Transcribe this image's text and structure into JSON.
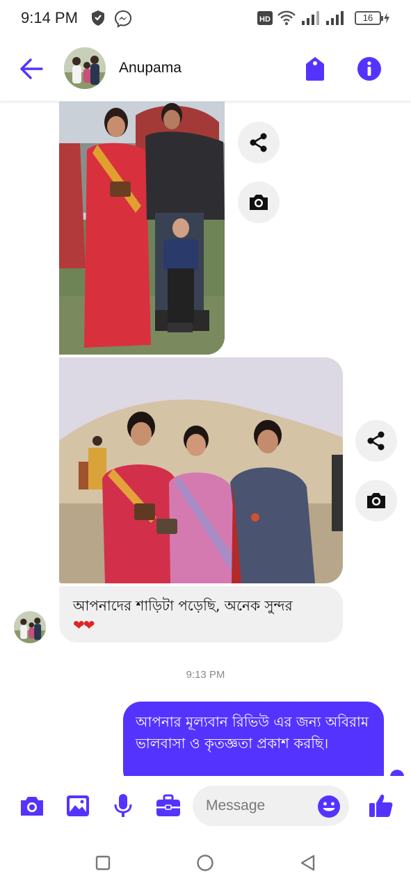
{
  "status_bar": {
    "time": "9:14 PM",
    "battery": "16"
  },
  "header": {
    "contact_name": "Anupama"
  },
  "messages": {
    "incoming_text": "আপনাদের শাড়িটা পড়েছি, অনেক সুন্দর",
    "incoming_emoji": "❤❤",
    "timestamp": "9:13 PM",
    "outgoing_text": "আপনার মূল্যবান রিভিউ এর জন্য অবিরাম ভালবাসা ও কৃতজ্ঞতা প্রকাশ করছি।"
  },
  "composer": {
    "placeholder": "Message"
  },
  "icons": {
    "status": [
      "vpn-shield-icon",
      "messenger-icon",
      "hd-icon",
      "wifi-icon",
      "signal-icon",
      "battery-icon"
    ],
    "header": [
      "back-arrow-icon",
      "tag-icon",
      "info-icon"
    ],
    "media_actions": [
      "share-icon",
      "camera-icon"
    ],
    "composer": [
      "camera-icon",
      "gallery-icon",
      "microphone-icon",
      "briefcase-icon",
      "emoji-icon",
      "thumbs-up-icon"
    ],
    "nav": [
      "recents-icon",
      "home-icon",
      "back-icon"
    ]
  },
  "colors": {
    "accent": "#5533ff",
    "incoming_bubble": "#f0f0f0",
    "heart": "#e02424"
  }
}
